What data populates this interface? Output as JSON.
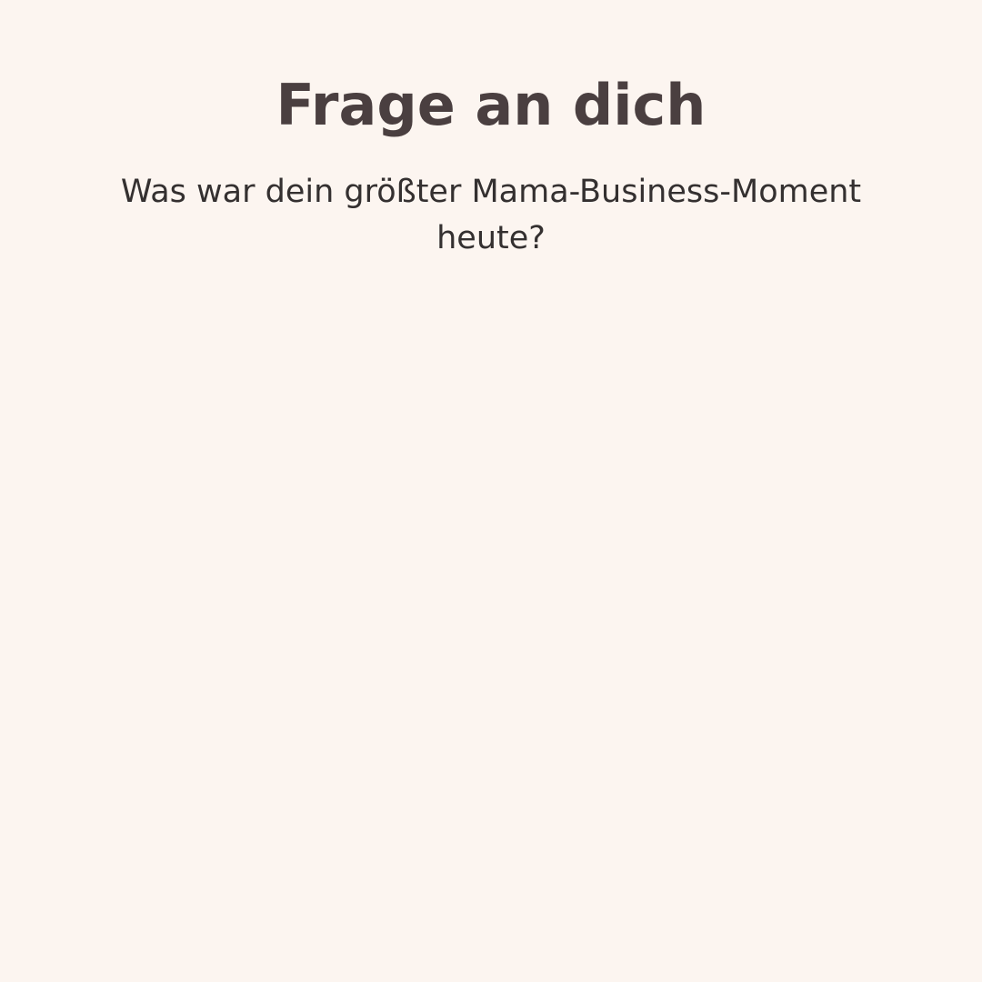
{
  "post": {
    "title": "Frage an dich",
    "question": "Was war dein größter Mama-Business-Moment heute?"
  },
  "colors": {
    "background": "#fcf5f0",
    "title": "#4a3f40",
    "question": "#343030"
  }
}
